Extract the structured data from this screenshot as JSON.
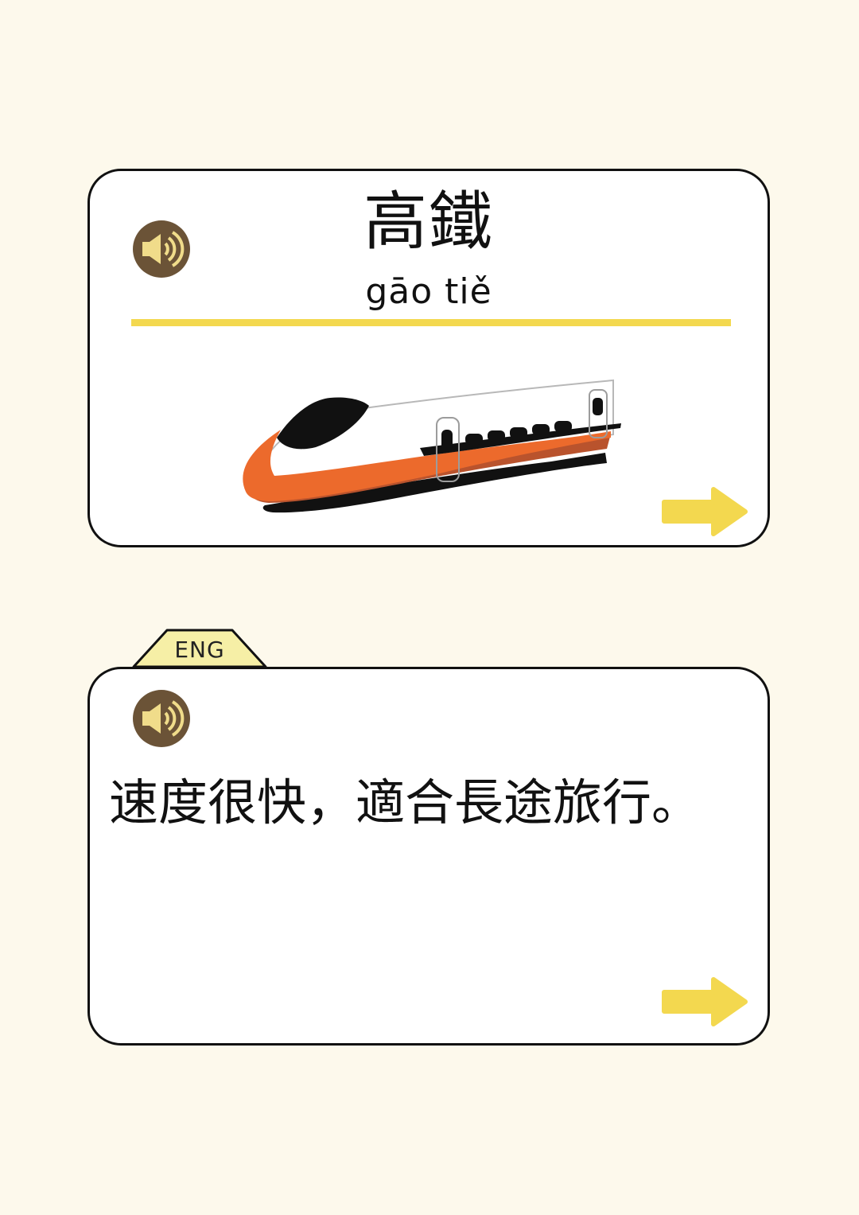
{
  "word_card": {
    "characters": "高鐵",
    "pinyin": "gāo tiě",
    "speaker_icon": "speaker-icon",
    "illustration": "high-speed-train",
    "next_icon": "arrow-right-icon"
  },
  "sentence_card": {
    "tab_label": "ENG",
    "sentence": "速度很快，適合長途旅行。",
    "speaker_icon": "speaker-icon",
    "next_icon": "arrow-right-icon"
  },
  "colors": {
    "background": "#fdf9ec",
    "accent_yellow": "#f3d84f",
    "speaker_brown": "#6b5337",
    "speaker_glyph": "#f0dc8a",
    "train_orange": "#ec6a2c",
    "train_rust": "#b9532d"
  }
}
